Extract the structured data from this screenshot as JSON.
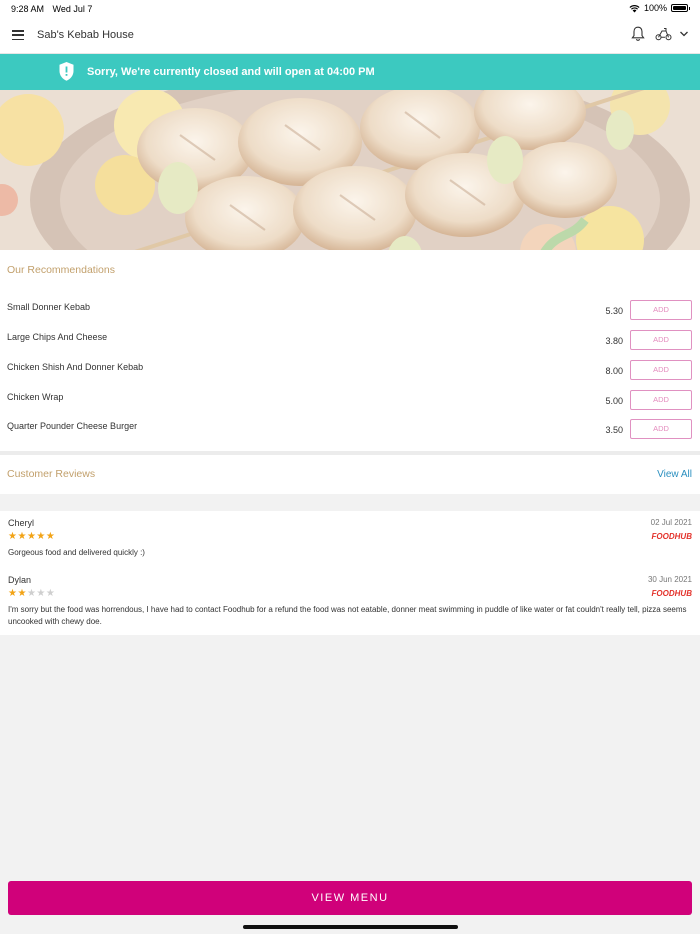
{
  "status_bar": {
    "time": "9:28 AM",
    "date": "Wed Jul 7",
    "battery": "100%"
  },
  "header": {
    "title": "Sab's Kebab House"
  },
  "banner": {
    "text": "Sorry, We're currently closed and will open at 04:00 PM",
    "color": "#3cc9c0"
  },
  "recommendations": {
    "title": "Our Recommendations",
    "add_label": "ADD",
    "items": [
      {
        "name": "Small Donner Kebab",
        "price": "5.30"
      },
      {
        "name": "Large Chips And Cheese",
        "price": "3.80"
      },
      {
        "name": "Chicken Shish And Donner Kebab",
        "price": "8.00"
      },
      {
        "name": "Chicken Wrap",
        "price": "5.00"
      },
      {
        "name": "Quarter Pounder Cheese Burger",
        "price": "3.50"
      }
    ]
  },
  "reviews": {
    "title": "Customer Reviews",
    "view_all": "View All",
    "source_label": "FOODHUB",
    "items": [
      {
        "name": "Cheryl",
        "date": "02 Jul 2021",
        "rating": 5,
        "text": "Gorgeous food and delivered quickly :)"
      },
      {
        "name": "Dylan",
        "date": "30 Jun 2021",
        "rating": 2,
        "text": "I'm sorry but the food was horrendous, I have had to contact Foodhub for a refund the food was not eatable, donner meat swimming in puddle of like water or fat couldn't really tell, pizza seems uncooked with chewy doe."
      }
    ]
  },
  "footer": {
    "view_menu": "VIEW MENU",
    "accent": "#d0017a"
  }
}
